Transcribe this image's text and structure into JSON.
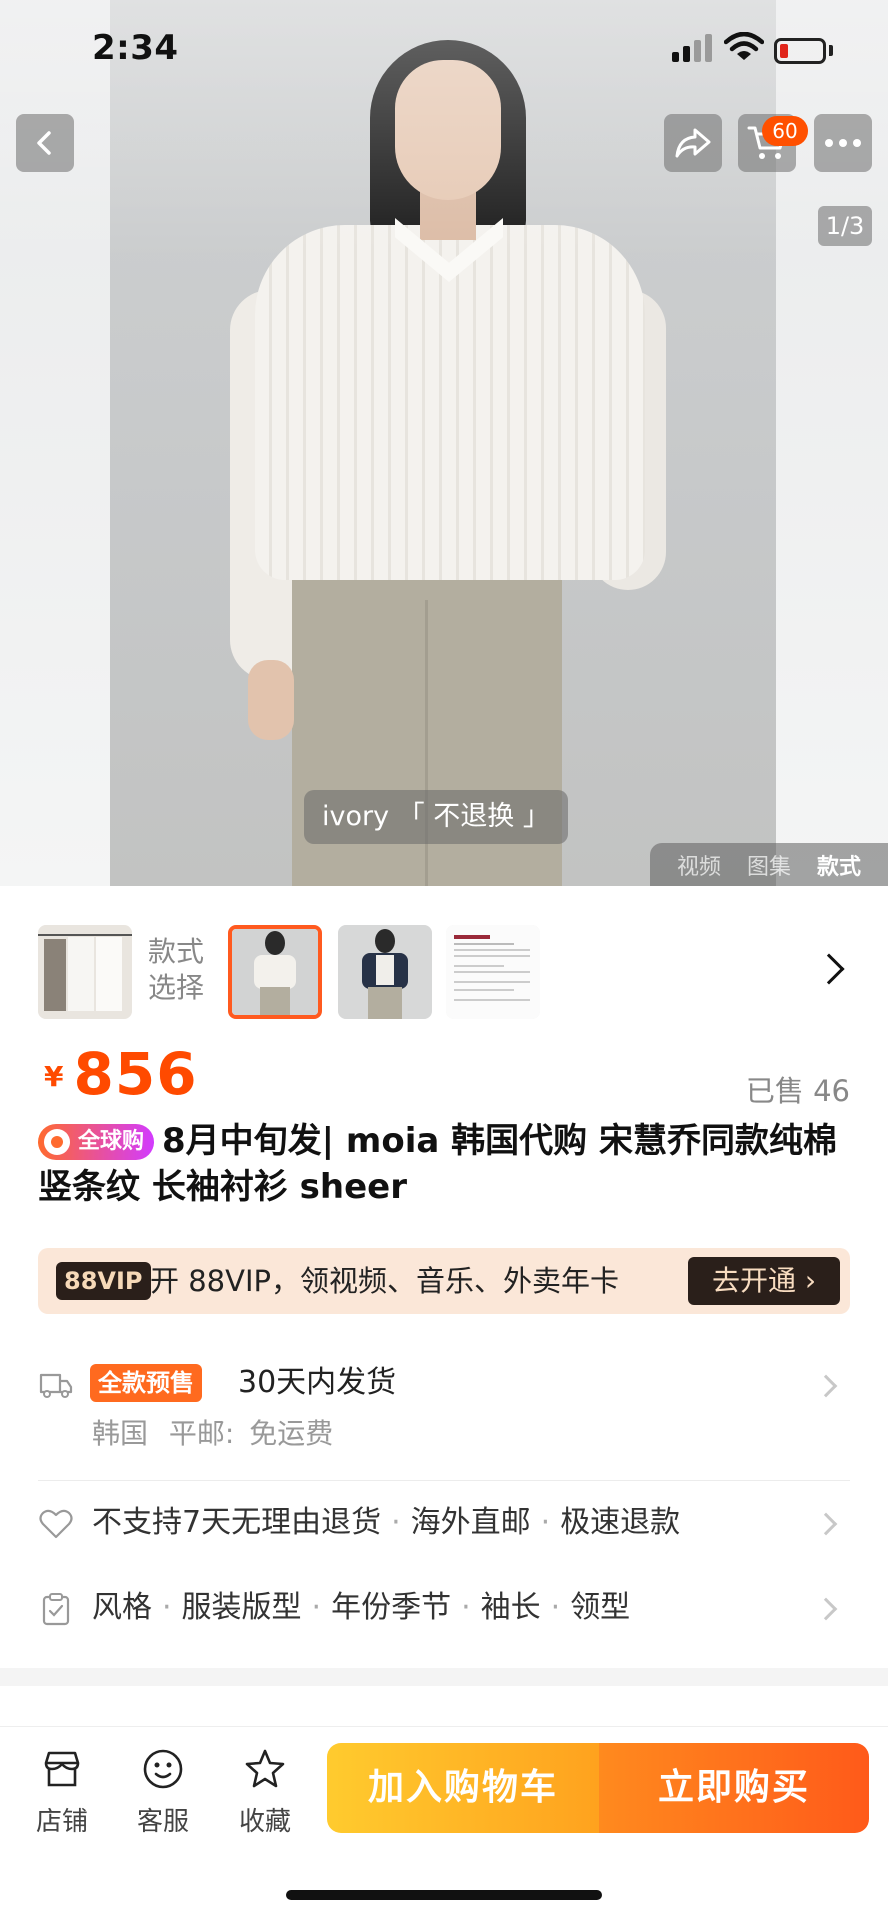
{
  "status_bar": {
    "time": "2:34"
  },
  "header": {
    "cart_count": "60",
    "page_indicator": "1/3"
  },
  "hero": {
    "caption": "ivory 「 不退换 」"
  },
  "media_tabs": [
    "视频",
    "图集",
    "款式"
  ],
  "style_selector": {
    "label_line1": "款式",
    "label_line2": "选择"
  },
  "product": {
    "currency": "¥",
    "price": "856",
    "sold": "已售 46",
    "badge": "全球购",
    "title": "8月中旬发| moia 韩国代购 宋慧乔同款纯棉竖条纹 长袖衬衫 sheer"
  },
  "vip": {
    "tag": "88VIP",
    "text": "开 88VIP，领视频、音乐、外卖年卡",
    "button": "去开通 ›"
  },
  "shipping": {
    "tag": "全款预售",
    "main": "30天内发货",
    "origin": "韩国",
    "postage_label": "平邮:",
    "postage_value": "免运费"
  },
  "guarantees": [
    "不支持7天无理由退货",
    "海外直邮",
    "极速退款"
  ],
  "attributes": [
    "风格",
    "服装版型",
    "年份季节",
    "袖长",
    "领型"
  ],
  "bottom_bar": {
    "shop": "店铺",
    "service": "客服",
    "favorite": "收藏",
    "add_to_cart": "加入购物车",
    "buy_now": "立即购买"
  },
  "colors": {
    "accent": "#ff5000",
    "price": "#ff4a00",
    "vip_dark": "#2a1f1a"
  }
}
